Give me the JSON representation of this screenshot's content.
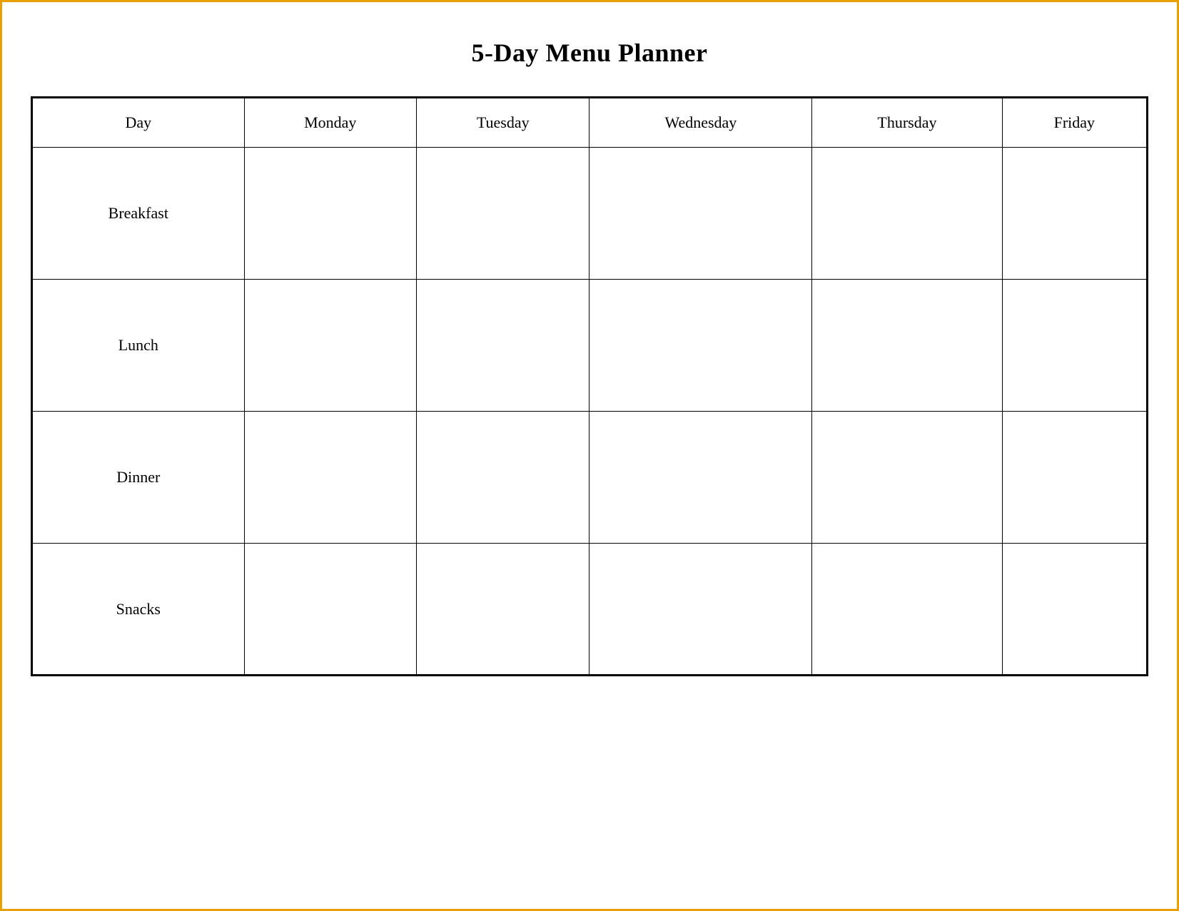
{
  "title": "5-Day Menu Planner",
  "columns": [
    {
      "id": "day",
      "label": "Day"
    },
    {
      "id": "monday",
      "label": "Monday"
    },
    {
      "id": "tuesday",
      "label": "Tuesday"
    },
    {
      "id": "wednesday",
      "label": "Wednesday"
    },
    {
      "id": "thursday",
      "label": "Thursday"
    },
    {
      "id": "friday",
      "label": "Friday"
    }
  ],
  "rows": [
    {
      "meal": "Breakfast",
      "monday": "",
      "tuesday": "",
      "wednesday": "",
      "thursday": "",
      "friday": ""
    },
    {
      "meal": "Lunch",
      "monday": "",
      "tuesday": "",
      "wednesday": "",
      "thursday": "",
      "friday": ""
    },
    {
      "meal": "Dinner",
      "monday": "",
      "tuesday": "",
      "wednesday": "",
      "thursday": "",
      "friday": ""
    },
    {
      "meal": "Snacks",
      "monday": "",
      "tuesday": "",
      "wednesday": "",
      "thursday": "",
      "friday": ""
    }
  ]
}
